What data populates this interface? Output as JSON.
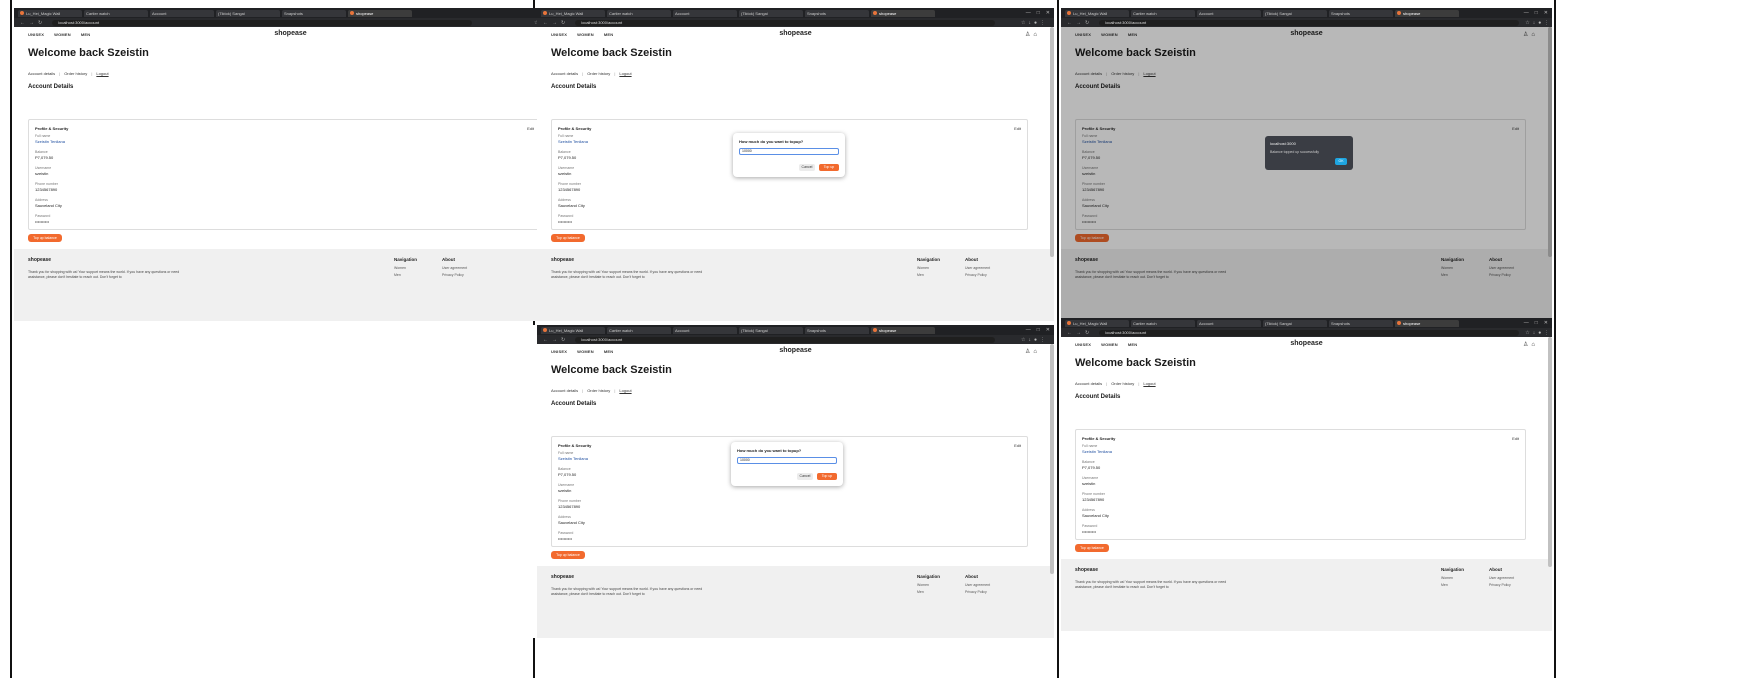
{
  "browser": {
    "tabs": [
      "Lu_Hei_Magic Wall",
      "Cartier watch",
      "Account",
      "(Tiktok) Sangai",
      "Snapshots",
      "shopease"
    ],
    "active_tab": "shopease",
    "url": "localhost:3000/account"
  },
  "site": {
    "nav": [
      "UNISEX",
      "WOMEN",
      "MEN"
    ],
    "logo": "shopease",
    "welcome": "Welcome back Szeistin",
    "subtabs": [
      "Account details",
      "Order history",
      "Logout"
    ],
    "section_title": "Account Details",
    "card": {
      "title": "Profile & Security",
      "edit": "Edit",
      "fields": [
        {
          "label": "Full name",
          "value": "Szeistin Tenilana",
          "blue": true
        },
        {
          "label": "Balance",
          "value": "P7,079.50",
          "blue": false
        },
        {
          "label": "Username",
          "value": "szeistin",
          "blue": false
        },
        {
          "label": "Phone number",
          "value": "1234567890",
          "blue": false
        },
        {
          "label": "Address",
          "value": "Sauveland City",
          "blue": false
        },
        {
          "label": "Password",
          "value": "••••••••••",
          "blue": false
        }
      ]
    },
    "topup_button": "Top up balance",
    "footer": {
      "brand": "shopease",
      "desc": "Thank you for shopping with us! Your support means the world. If you have any questions or need assistance, please don't hesitate to reach out. Don't forget to",
      "nav_title": "Navigation",
      "nav_items": [
        "Women",
        "Men"
      ],
      "about_title": "About",
      "about_items": [
        "User agreement",
        "Privacy Policy"
      ]
    }
  },
  "dialog": {
    "question": "How much do you want to topup?",
    "value": "10000",
    "cancel": "Cancel",
    "topup": "Top up"
  },
  "alert": {
    "title": "localhost:3000",
    "message": "Balance topped up successfully",
    "ok": "OK"
  }
}
